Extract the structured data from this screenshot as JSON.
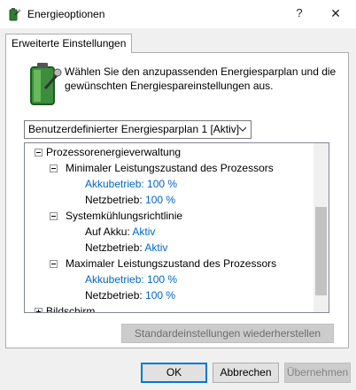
{
  "window": {
    "title": "Energieoptionen",
    "help": "?",
    "close": "✕"
  },
  "tab": {
    "label": "Erweiterte Einstellungen"
  },
  "description": "Wählen Sie den anzupassenden Energiesparplan und die gewünschten Energiespareinstellungen aus.",
  "plan_select": {
    "selected": "Benutzerdefinierter Energiesparplan 1 [Aktiv]"
  },
  "tree": {
    "processor_group": "Prozessorenergieverwaltung",
    "min_state": {
      "label": "Minimaler Leistungszustand des Prozessors",
      "battery_label": "Akkubetrieb:",
      "battery_value": "100 %",
      "ac_label": "Netzbetrieb:",
      "ac_value": "100 %"
    },
    "cooling": {
      "label": "Systemkühlungsrichtlinie",
      "battery_label": "Auf Akku:",
      "battery_value": "Aktiv",
      "ac_label": "Netzbetrieb:",
      "ac_value": "Aktiv"
    },
    "max_state": {
      "label": "Maximaler Leistungszustand des Prozessors",
      "battery_label": "Akkubetrieb:",
      "battery_value": "100 %",
      "ac_label": "Netzbetrieb:",
      "ac_value": "100 %"
    },
    "display_group": "Bildschirm"
  },
  "buttons": {
    "restore": "Standardeinstellungen wiederherstellen",
    "ok": "OK",
    "cancel": "Abbrechen",
    "apply": "Übernehmen"
  },
  "colors": {
    "link": "#0066cc",
    "accent": "#0078d7"
  }
}
